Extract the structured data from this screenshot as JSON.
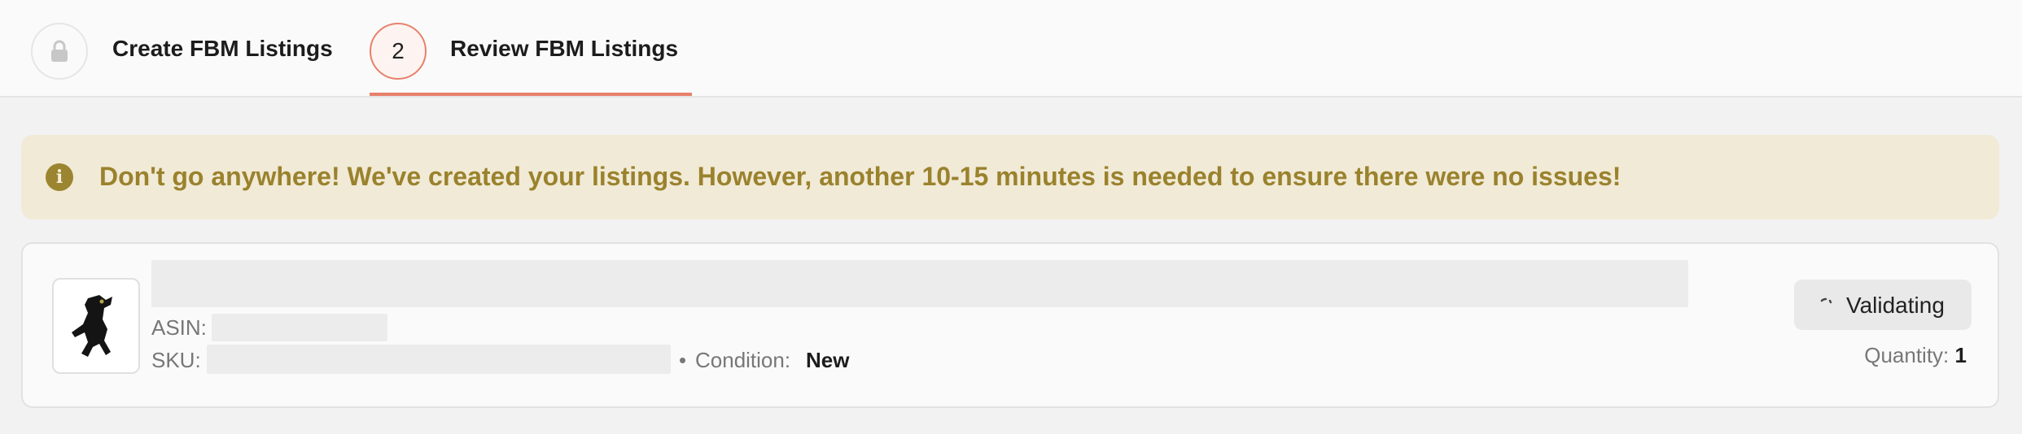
{
  "stepper": {
    "steps": [
      {
        "icon": "lock-icon",
        "label": "Create FBM Listings",
        "state": "completed"
      },
      {
        "number": "2",
        "label": "Review FBM Listings",
        "state": "active"
      }
    ],
    "accent_color": "#e8806b"
  },
  "alert": {
    "icon": "info-icon",
    "icon_glyph": "i",
    "text": "Don't go anywhere! We've created your listings. However, another 10-15 minutes is needed to ensure there were no issues!",
    "background_color": "#f1ead6",
    "text_color": "#9a822d"
  },
  "listing": {
    "image": "product-thumbnail",
    "asin_label": "ASIN:",
    "sku_label": "SKU:",
    "separator": "•",
    "condition_label": "Condition:",
    "condition_value": "New",
    "status": {
      "icon": "spinner-icon",
      "label": "Validating"
    },
    "quantity_label": "Quantity:",
    "quantity_value": "1"
  }
}
